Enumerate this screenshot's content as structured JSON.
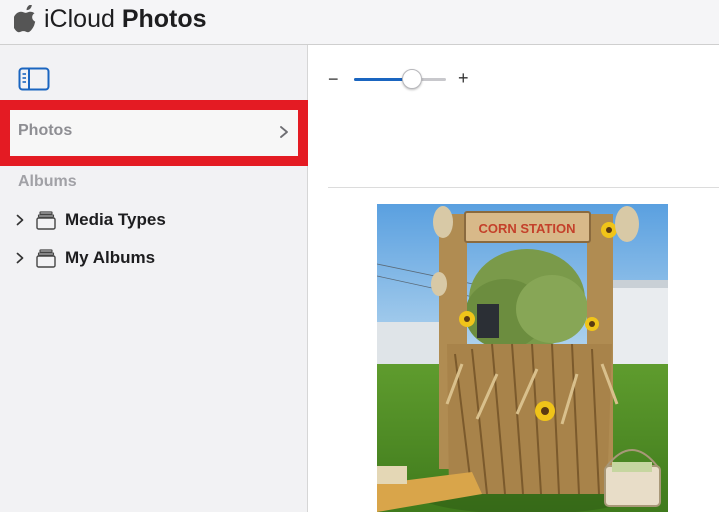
{
  "header": {
    "brand": "iCloud",
    "product": "Photos",
    "logo_icon": "apple-logo-icon"
  },
  "sidebar": {
    "toggle_icon": "sidebar-toggle-icon",
    "photos_item": {
      "label": "Photos",
      "icon": "chevron-right-icon",
      "selected": true
    },
    "albums_section": {
      "label": "Albums"
    },
    "album_groups": [
      {
        "label": "Media Types",
        "icon": "folder-icon"
      },
      {
        "label": "My Albums",
        "icon": "folder-icon"
      }
    ]
  },
  "toolbar": {
    "zoom_out_label": "−",
    "zoom_in_label": "+",
    "zoom_level": 0.63
  },
  "photo_grid": {
    "photos": [
      {
        "sign_text": "CORN STATION"
      }
    ]
  },
  "colors": {
    "accent": "#1a65c0",
    "highlight": "#e41b23",
    "sidebar_bg": "#f2f2f4"
  }
}
